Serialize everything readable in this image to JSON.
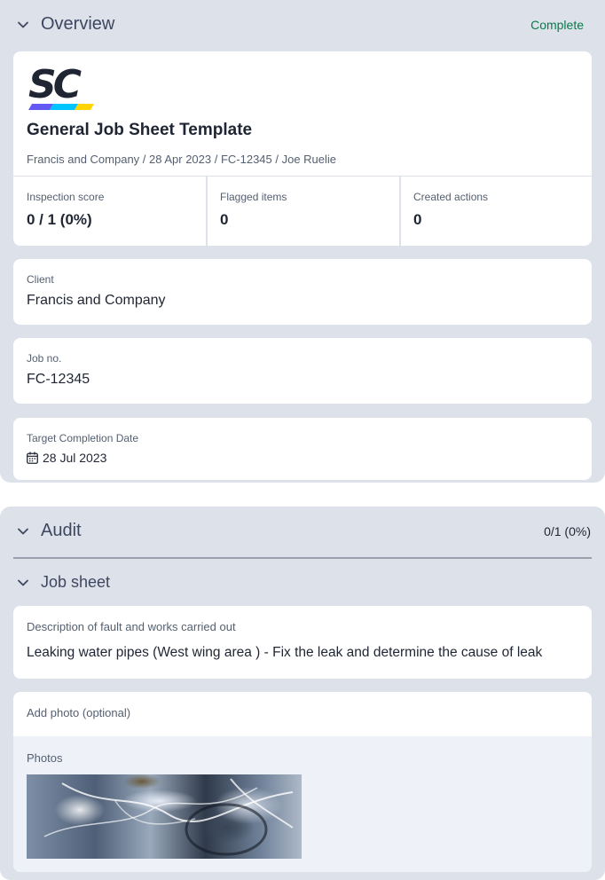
{
  "overview": {
    "title": "Overview",
    "status": "Complete",
    "logo_text": "SC",
    "template_title": "General Job Sheet Template",
    "meta_line": "Francis and Company / 28 Apr 2023 / FC-12345 / Joe Ruelie",
    "stats": [
      {
        "label": "Inspection score",
        "value": "0 / 1 (0%)"
      },
      {
        "label": "Flagged items",
        "value": "0"
      },
      {
        "label": "Created actions",
        "value": "0"
      }
    ],
    "fields": {
      "client": {
        "label": "Client",
        "value": "Francis and Company"
      },
      "job_no": {
        "label": "Job no.",
        "value": "FC-12345"
      },
      "target_date": {
        "label": "Target Completion Date",
        "value": "28 Jul 2023"
      }
    }
  },
  "audit": {
    "title": "Audit",
    "score": "0/1 (0%)",
    "subsection_title": "Job sheet",
    "description": {
      "label": "Description of fault and works carried out",
      "value": "Leaking water pipes (West wing area ) - Fix the leak and determine the cause of leak"
    },
    "add_photo_label": "Add photo (optional)",
    "photos_label": "Photos"
  },
  "colors": {
    "section_bg": "#dde1ea",
    "status_green": "#0a7a4a",
    "logo_dark": "#1f2533",
    "logo_purple": "#6559f5",
    "logo_cyan": "#00c3ff",
    "logo_yellow": "#ffd400"
  },
  "icons": [
    "chevron-down-icon",
    "calendar-icon"
  ]
}
